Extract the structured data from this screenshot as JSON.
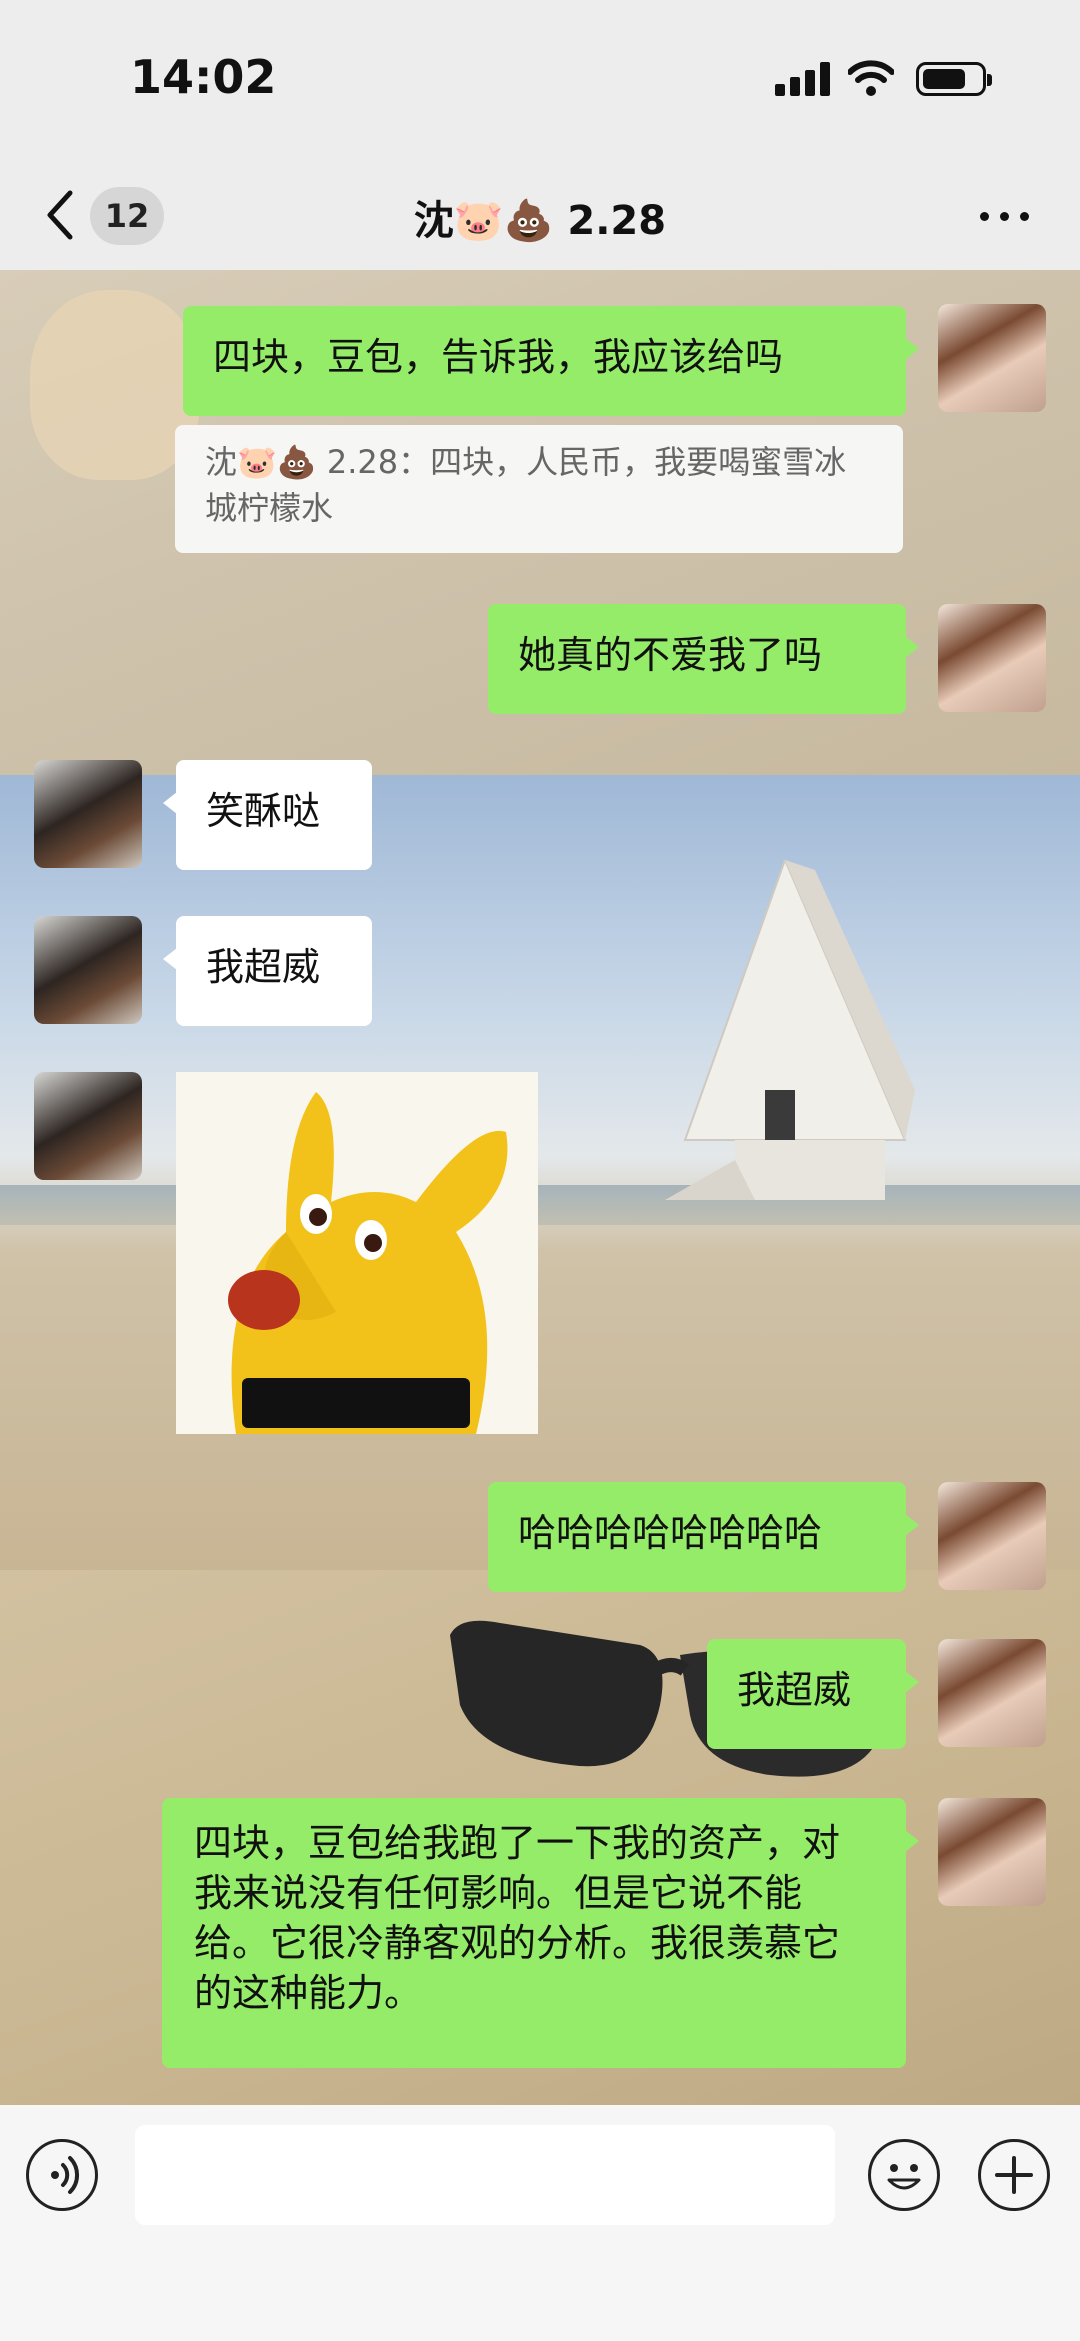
{
  "status": {
    "time": "14:02"
  },
  "nav": {
    "unread": "12",
    "title": "沈🐷💩 2.28"
  },
  "messages": [
    {
      "side": "right",
      "text": "四块，豆包，告诉我，我应该给吗"
    },
    {
      "side": "quote",
      "text": "沈🐷💩 2.28：四块，人民币，我要喝蜜雪冰城柠檬水"
    },
    {
      "side": "right",
      "text": "她真的不爱我了吗"
    },
    {
      "side": "left",
      "text": "笑酥哒"
    },
    {
      "side": "left",
      "text": "我超威"
    },
    {
      "side": "left",
      "type": "sticker"
    },
    {
      "side": "right",
      "text": "哈哈哈哈哈哈哈哈"
    },
    {
      "side": "right",
      "text": "我超威"
    },
    {
      "side": "right",
      "text": "四块，豆包给我跑了一下我的资产，对我来说没有任何影响。但是它说不能给。它很冷静客观的分析。我很羡慕它的这种能力。"
    }
  ],
  "colors": {
    "bubble_sent": "#95ec69",
    "bubble_received": "#ffffff",
    "background": "#ededed"
  },
  "icons": [
    "back-arrow-icon",
    "more-icon",
    "voice-icon",
    "emoji-icon",
    "plus-icon"
  ]
}
